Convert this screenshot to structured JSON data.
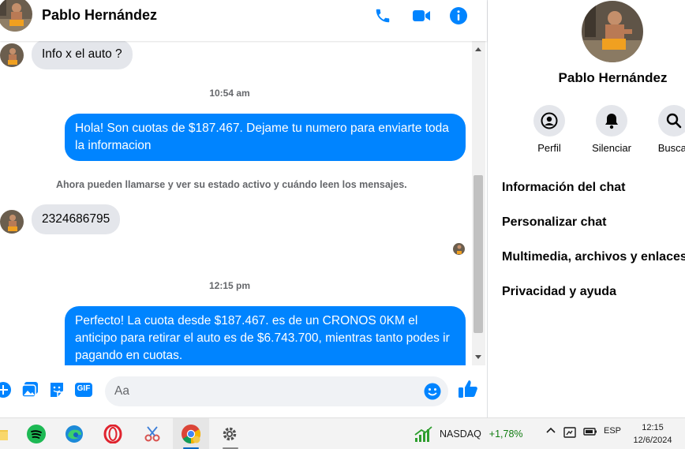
{
  "header": {
    "contact_name": "Pablo Hernández",
    "call_icon": "phone-icon",
    "video_icon": "video-camera-icon",
    "info_icon": "info-icon"
  },
  "messages": {
    "incoming_1": "Info x el auto ?",
    "timestamp_1": "10:54 am",
    "outgoing_1": "Hola! Son cuotas de $187.467. Dejame tu numero para enviarte toda la informacion",
    "system_notice": "Ahora pueden llamarse y ver su estado activo y cuándo leen los mensajes.",
    "incoming_2": "2324686795",
    "timestamp_2": "12:15 pm",
    "outgoing_2": "Perfecto! La cuota desde $187.467. es de un CRONOS 0KM el anticipo para retirar el auto es de $6.743.700, mientras tanto podes ir pagando en cuotas."
  },
  "composer": {
    "placeholder": "Aa",
    "icons": [
      "plus-icon",
      "image-icon",
      "sticker-icon",
      "gif-icon",
      "emoji-icon",
      "thumbs-up-icon"
    ],
    "gif_label": "GIF"
  },
  "info_panel": {
    "name": "Pablo Hernández",
    "actions": [
      {
        "label": "Perfil",
        "icon": "profile-icon"
      },
      {
        "label": "Silenciar",
        "icon": "bell-icon"
      },
      {
        "label": "Buscar",
        "icon": "search-icon"
      }
    ],
    "menu": [
      "Información del chat",
      "Personalizar chat",
      "Multimedia, archivos y enlaces",
      "Privacidad y ayuda"
    ]
  },
  "taskbar": {
    "apps": [
      "file-explorer-icon",
      "spotify-icon",
      "edge-icon",
      "opera-icon",
      "snipping-icon",
      "chrome-icon",
      "settings-icon"
    ],
    "stock_name": "NASDAQ",
    "stock_change": "+1,78%",
    "language": "ESP",
    "time": "12:15",
    "date": "12/6/2024"
  },
  "colors": {
    "accent": "#0084ff",
    "incoming_bubble": "#e4e6eb",
    "secondary_text": "#65676b",
    "stock_positive": "#107c10"
  }
}
